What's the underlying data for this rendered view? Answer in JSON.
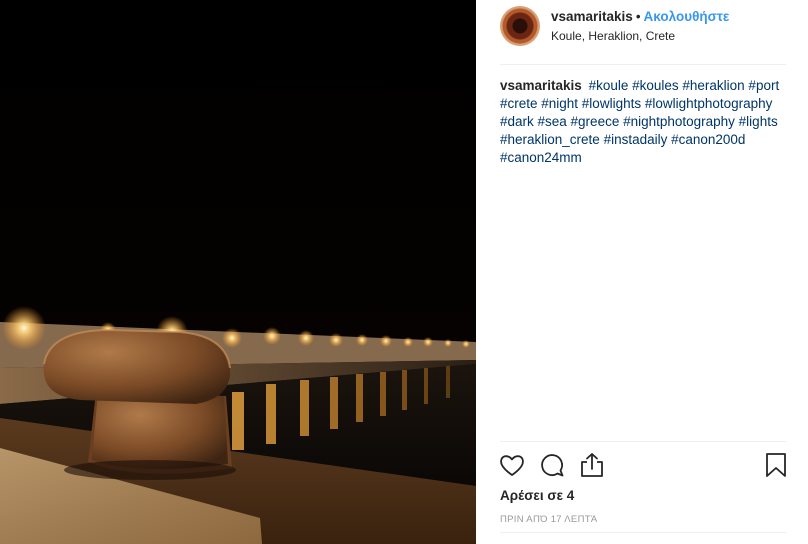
{
  "post": {
    "username": "vsamaritakis",
    "separator": "•",
    "follow_label": "Ακολουθήστε",
    "location": "Koule, Heraklion, Crete",
    "caption_user": "vsamaritakis",
    "caption_tags": "#koule #koules #heraklion #port #crete #night #lowlights #lowlightphotography #dark #sea #greece #nightphotography #lights #heraklion_crete #instadaily #canon200d #canon24mm",
    "likes_text": "Αρέσει σε 4",
    "time_text": "ΠΡΙΝ ΑΠΌ 17 ΛΕΠΤΆ"
  },
  "photo": {
    "subject": "night harbour pier with bollard and lights"
  },
  "colors": {
    "link": "#3897f0",
    "hashtag": "#003569",
    "text": "#262626",
    "muted": "#999999"
  },
  "icons": {
    "like": "heart-outline-icon",
    "comment": "speech-bubble-icon",
    "share": "share-upload-icon",
    "save": "bookmark-icon"
  }
}
